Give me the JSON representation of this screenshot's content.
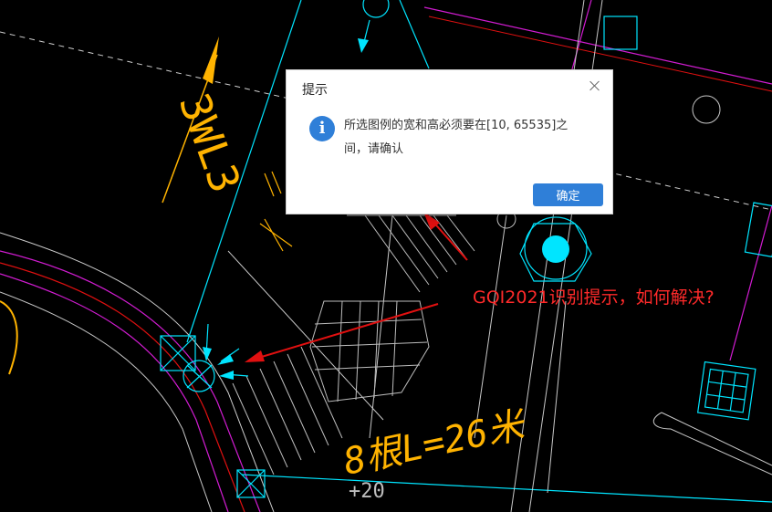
{
  "dialog": {
    "title": "提示",
    "message": "所选图例的宽和高必须要在[10, 65535]之间，请确认",
    "ok_label": "确定",
    "icon": "info-icon",
    "close_icon": "close-icon"
  },
  "annotation": {
    "text": "GQI2021识别提示，如何解决?"
  },
  "cad": {
    "labels": [
      "3WL3",
      "8根L=26米",
      "+20"
    ]
  },
  "colors": {
    "background": "#000000",
    "accent": "#2f7fd8",
    "annotation_red": "#ff2a2a",
    "cad_cyan": "#00e5ff",
    "cad_yellow": "#ffb300",
    "cad_magenta": "#d21cd2"
  }
}
